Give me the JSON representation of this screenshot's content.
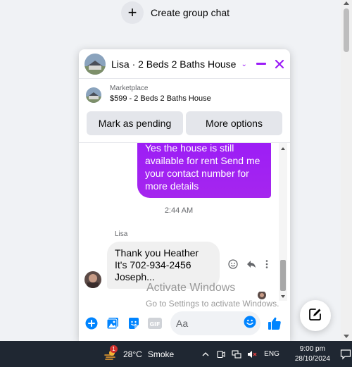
{
  "top": {
    "create_group_label": "Create group chat"
  },
  "chat": {
    "title": "Lisa · 2 Beds 2 Baths House",
    "listing": {
      "source": "Marketplace",
      "price_title": "$599 - 2 Beds 2 Baths House"
    },
    "actions": {
      "mark_pending": "Mark as pending",
      "more_options": "More options"
    },
    "messages": {
      "outgoing_text": "Yes the house is still available for rent Send me your contact number for more details",
      "timestamp": "2:44 AM",
      "sender": "Lisa",
      "incoming_text": "Thank you Heather It's 702-934-2456 Joseph..."
    },
    "composer": {
      "placeholder": "Aa"
    }
  },
  "watermark": {
    "title": "Activate Windows",
    "subtitle": "Go to Settings to activate Windows."
  },
  "taskbar": {
    "weather_badge": "1",
    "temperature": "28°C",
    "condition": "Smoke",
    "language": "ENG",
    "time": "9:00 pm",
    "date": "28/10/2024"
  },
  "colors": {
    "accent": "#9b1cf7",
    "messenger_blue": "#0084ff",
    "taskbar": "#1f2732"
  }
}
